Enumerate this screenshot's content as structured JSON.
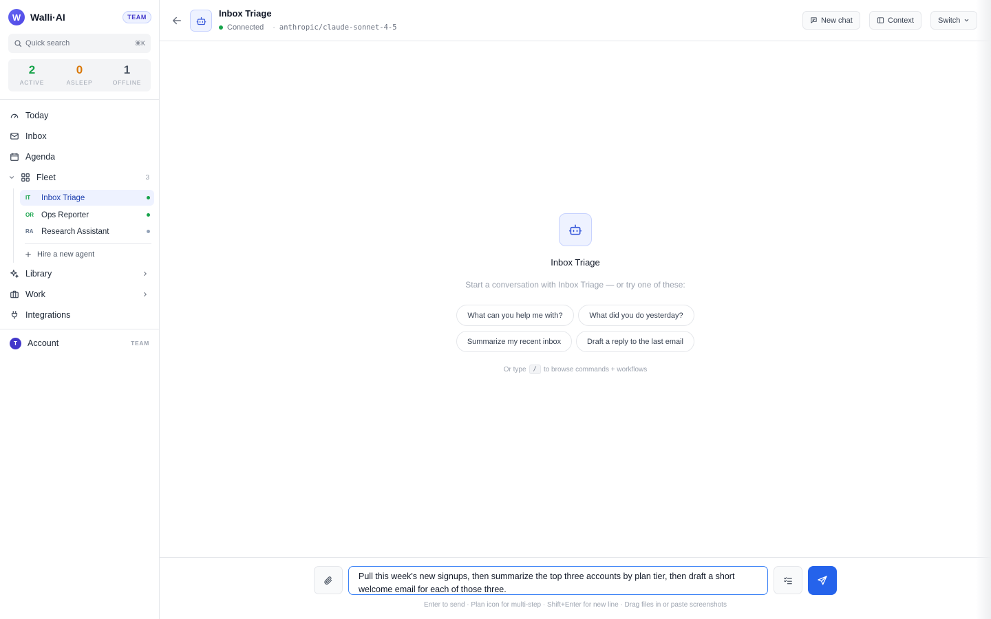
{
  "brand": {
    "logo_letter": "W",
    "name": "Walli·AI",
    "badge": "TEAM"
  },
  "search": {
    "placeholder": "Quick search",
    "shortcut": "⌘K"
  },
  "stats": [
    {
      "value": "2",
      "label": "ACTIVE",
      "color": "#16a34a"
    },
    {
      "value": "0",
      "label": "ASLEEP",
      "color": "#d97706"
    },
    {
      "value": "1",
      "label": "OFFLINE",
      "color": "#4b5563"
    }
  ],
  "nav": {
    "today": "Today",
    "inbox": "Inbox",
    "agenda": "Agenda",
    "fleet": "Fleet",
    "fleet_count": "3",
    "library": "Library",
    "work": "Work",
    "integrations": "Integrations"
  },
  "fleet": {
    "agents": [
      {
        "abbr": "IT",
        "name": "Inbox Triage",
        "status": "active",
        "abbr_color": "#16a34a",
        "dot_color": "#16a34a"
      },
      {
        "abbr": "OR",
        "name": "Ops Reporter",
        "status": "active",
        "abbr_color": "#16a34a",
        "dot_color": "#16a34a"
      },
      {
        "abbr": "RA",
        "name": "Research Assistant",
        "status": "offline",
        "abbr_color": "#64748b",
        "dot_color": "#94a3b8"
      }
    ],
    "hire_label": "Hire a new agent"
  },
  "account": {
    "avatar_letter": "T",
    "label": "Account",
    "badge": "TEAM"
  },
  "header": {
    "title": "Inbox Triage",
    "status": "Connected",
    "separator": "·",
    "model": "anthropic/claude-sonnet-4-5",
    "new_chat": "New chat",
    "context": "Context",
    "switch": "Switch"
  },
  "empty_state": {
    "title": "Inbox Triage",
    "subtitle": "Start a conversation with Inbox Triage — or try one of these:",
    "suggestions": [
      "What can you help me with?",
      "What did you do yesterday?",
      "Summarize my recent inbox",
      "Draft a reply to the last email"
    ],
    "hint_prefix": "Or type",
    "hint_key": "/",
    "hint_suffix": "to browse commands + workflows"
  },
  "composer": {
    "value": "Pull this week's new signups, then summarize the top three accounts by plan tier, then draft a short welcome email for each of those three.",
    "hint": "Enter to send · Plan icon for multi-step · Shift+Enter for new line · Drag files in or paste screenshots"
  },
  "colors": {
    "accent": "#2563eb",
    "active_bg": "#eef2ff",
    "status_green": "#16a34a"
  }
}
